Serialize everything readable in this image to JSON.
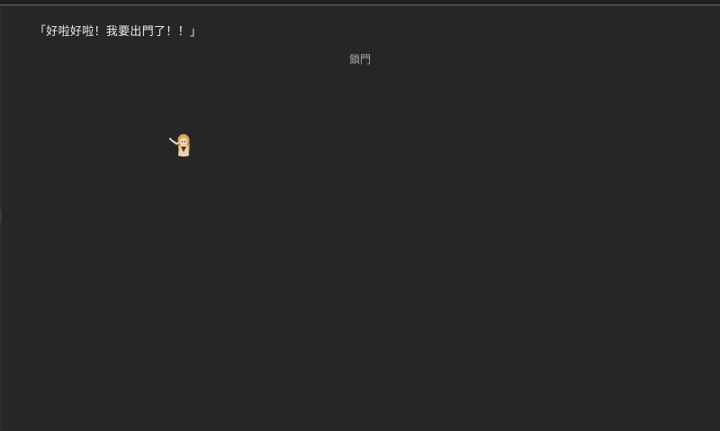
{
  "scene": {
    "dialogue_text": "「好啦好啦！我要出門了！！」",
    "choice_label": "鎖門",
    "character_sprite": "girl-pointing-sprite"
  }
}
